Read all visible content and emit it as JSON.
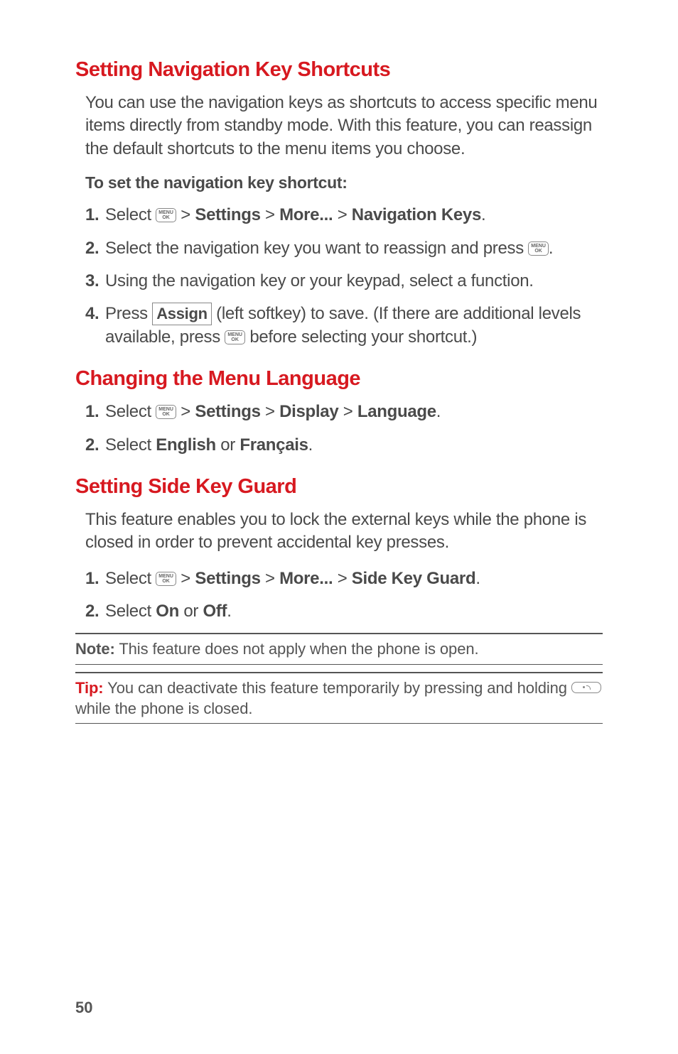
{
  "section1": {
    "heading": "Setting Navigation Key Shortcuts",
    "intro": "You can use the navigation keys as shortcuts to access specific menu items directly from standby mode. With this feature, you can reassign the default shortcuts to the menu items you choose.",
    "sub": "To set the navigation key shortcut:",
    "steps": [
      {
        "n": "1.",
        "pre": "Select ",
        "menuok": true,
        "mid": " > ",
        "b1": "Settings",
        "mid2": " > ",
        "b2": "More...",
        "mid3": " > ",
        "b3": "Navigation Keys",
        "post": "."
      },
      {
        "n": "2.",
        "pre": "Select the navigation key you want to reassign and press ",
        "menuok": true,
        "post": "."
      },
      {
        "n": "3.",
        "pre": "Using the navigation key or your keypad, select a function."
      },
      {
        "n": "4.",
        "pre": "Press ",
        "softkey": "Assign",
        "mid": " (left softkey) to save. (If there are additional levels available, press ",
        "menuok2": true,
        "post": " before selecting your shortcut.)"
      }
    ]
  },
  "section2": {
    "heading": "Changing the Menu Language",
    "steps": [
      {
        "n": "1.",
        "pre": "Select ",
        "menuok": true,
        "mid": " > ",
        "b1": "Settings",
        "mid2": " > ",
        "b2": "Display",
        "mid3": " > ",
        "b3": "Language",
        "post": "."
      },
      {
        "n": "2.",
        "pre": "Select ",
        "b1": "English",
        "mid": " or ",
        "b2": "Français",
        "post": "."
      }
    ]
  },
  "section3": {
    "heading": "Setting Side Key Guard",
    "intro": "This feature enables you to lock the external keys while the phone is closed in order to prevent accidental key presses.",
    "steps": [
      {
        "n": "1.",
        "pre": "Select ",
        "menuok": true,
        "mid": " > ",
        "b1": "Settings",
        "mid2": " > ",
        "b2": "More...",
        "mid3": " > ",
        "b3": "Side Key Guard",
        "post": "."
      },
      {
        "n": "2.",
        "pre": "Select ",
        "b1": "On",
        "mid": " or ",
        "b2": "Off",
        "post": "."
      }
    ]
  },
  "note": {
    "label": "Note:",
    "text": " This feature does not apply when the phone is open."
  },
  "tip": {
    "label": "Tip:",
    "text1": " You can deactivate this feature temporarily by pressing and holding ",
    "text2": " while the phone is closed."
  },
  "pagenum": "50",
  "menuok_top": "MENU",
  "menuok_bot": "OK"
}
